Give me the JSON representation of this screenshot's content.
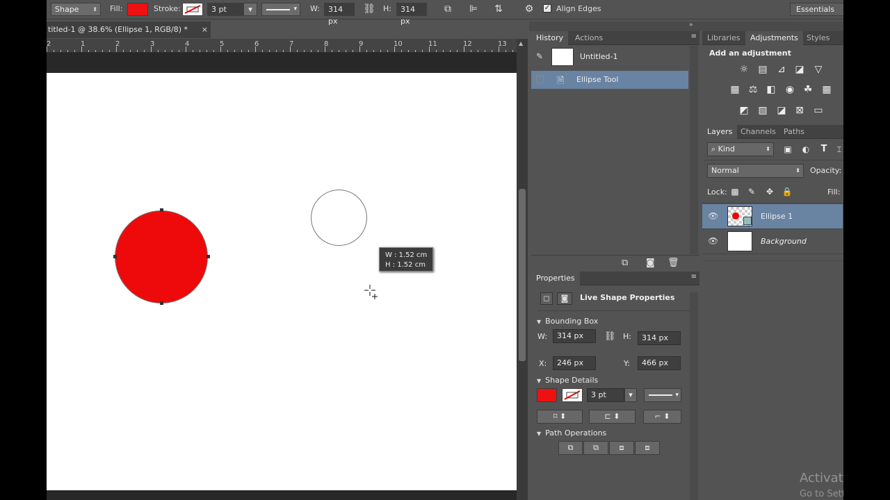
{
  "optbar": {
    "tool_mode": "Shape",
    "fill_label": "Fill:",
    "stroke_label": "Stroke:",
    "stroke_width": "3 pt",
    "w_label": "W:",
    "w_value": "314 px",
    "h_label": "H:",
    "h_value": "314 px",
    "align_edges": "Align Edges",
    "workspace": "Essentials",
    "fill_color": "#ee1111"
  },
  "document": {
    "tab_title": "titled-1 @ 38.6% (Ellipse 1, RGB/8) *",
    "close": "×",
    "ruler_labels": [
      "2",
      "1",
      "2",
      "3",
      "4",
      "5",
      "6",
      "7",
      "8",
      "9",
      "10",
      "11",
      "12",
      "13"
    ],
    "measure_w": "W :   1.52 cm",
    "measure_h": "H :   1.52 cm"
  },
  "history": {
    "tabs": [
      "History",
      "Actions"
    ],
    "items": [
      "Untitled-1",
      "Ellipse Tool"
    ]
  },
  "properties": {
    "tab": "Properties",
    "title": "Live Shape Properties",
    "bounding_box": "Bounding Box",
    "w_label": "W:",
    "w_value": "314 px",
    "h_label": "H:",
    "h_value": "314 px",
    "x_label": "X:",
    "x_value": "246 px",
    "y_label": "Y:",
    "y_value": "466 px",
    "shape_details": "Shape Details",
    "stroke_width": "3 pt",
    "path_operations": "Path Operations"
  },
  "adjustments": {
    "tabs": [
      "Libraries",
      "Adjustments",
      "Styles"
    ],
    "heading": "Add an adjustment"
  },
  "layers": {
    "tabs": [
      "Layers",
      "Channels",
      "Paths"
    ],
    "kind": "Kind",
    "blend_mode": "Normal",
    "opacity_label": "Opacity:",
    "lock_label": "Lock:",
    "fill_label": "Fill:",
    "items": [
      "Ellipse 1",
      "Background"
    ]
  },
  "watermark": {
    "line1": "Activate Wir",
    "line2": "Go to Settings to"
  }
}
